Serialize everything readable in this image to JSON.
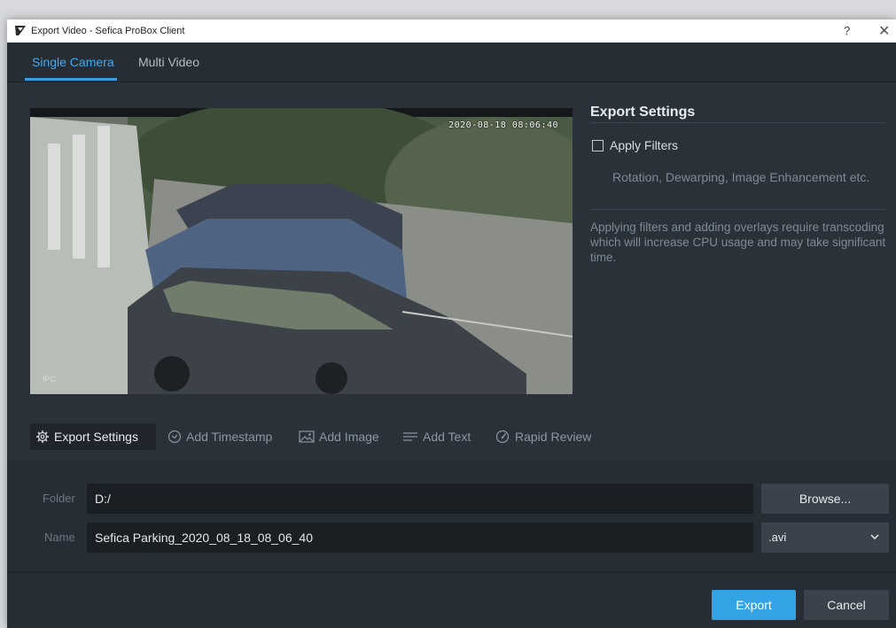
{
  "window": {
    "title": "Export Video - Sefica ProBox Client",
    "help_label": "?",
    "close_label": "✕"
  },
  "tabs": [
    {
      "label": "Single Camera",
      "active": true
    },
    {
      "label": "Multi Video",
      "active": false
    }
  ],
  "video": {
    "timestamp": "2020-08-18 08:06:40",
    "camera_tag": "IPC"
  },
  "export_settings": {
    "title": "Export Settings",
    "apply_filters_label": "Apply Filters",
    "apply_filters_checked": false,
    "filters_description": "Rotation, Dewarping, Image Enhancement etc.",
    "transcode_note": "Applying filters and adding overlays require transcoding which will increase CPU usage and may take significant time."
  },
  "toolbar": {
    "items": [
      {
        "label": "Export Settings",
        "icon": "gear-icon",
        "active": true
      },
      {
        "label": "Add Timestamp",
        "icon": "clock-icon",
        "active": false
      },
      {
        "label": "Add Image",
        "icon": "image-icon",
        "active": false
      },
      {
        "label": "Add Text",
        "icon": "text-lines-icon",
        "active": false
      },
      {
        "label": "Rapid Review",
        "icon": "speedometer-icon",
        "active": false
      }
    ]
  },
  "form": {
    "folder_label": "Folder",
    "folder_value": "D:/",
    "browse_label": "Browse...",
    "name_label": "Name",
    "name_value": "Sefica Parking_2020_08_18_08_06_40",
    "format_value": ".avi"
  },
  "actions": {
    "export_label": "Export",
    "cancel_label": "Cancel"
  },
  "colors": {
    "accent": "#33a3e6",
    "background": "#2a3139"
  }
}
